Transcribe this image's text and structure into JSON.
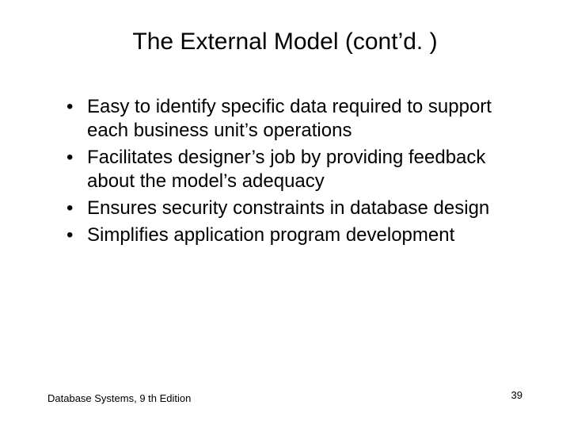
{
  "slide": {
    "title": "The External Model (cont’d. )",
    "bullets": [
      "Easy to identify specific data required to support each business unit’s operations",
      "Facilitates designer’s job by providing feedback about the model’s adequacy",
      "Ensures security constraints in database design",
      "Simplifies application program development"
    ],
    "footer_left": "Database Systems, 9 th Edition",
    "page_number": "39"
  }
}
